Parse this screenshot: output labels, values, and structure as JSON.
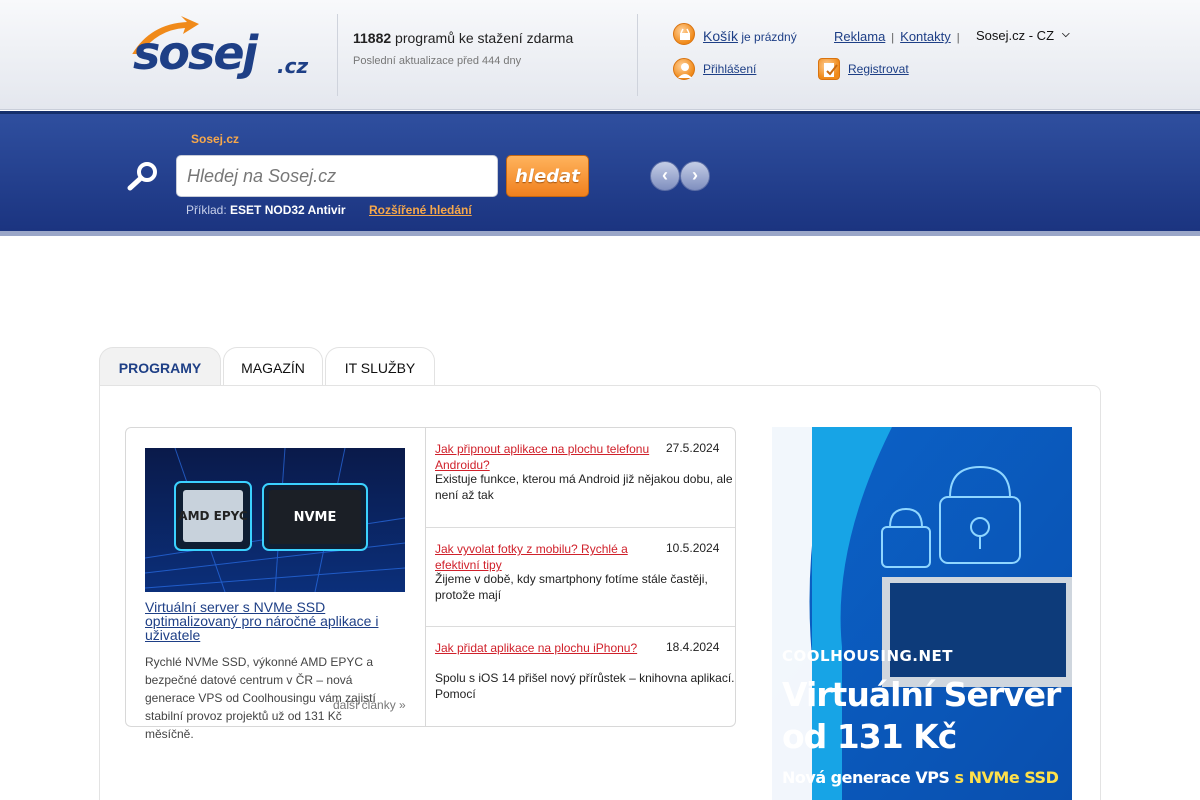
{
  "header": {
    "logo_text": "sosej",
    "logo_domain": ".cz",
    "program_count": "11882",
    "program_count_suffix": " programů ke stažení zdarma",
    "last_update": "Poslední aktualizace před 444 dny",
    "cart_link": "Košík",
    "cart_status": " je prázdný",
    "login_link": "Přihlášení",
    "register_link": "Registrovat",
    "top_links": [
      "Reklama",
      "Kontakty"
    ],
    "language_selected": "Sosej.cz - CZ"
  },
  "search": {
    "breadcrumb": "Sosej.cz",
    "placeholder": "Hledej na Sosej.cz",
    "button_label": "hledat",
    "example_label": "Příklad: ",
    "example_value": "ESET NOD32 Antivir",
    "advanced_link": "Rozšířené hledání"
  },
  "tabs": [
    {
      "label": "PROGRAMY",
      "active": true
    },
    {
      "label": "MAGAZÍN",
      "active": false
    },
    {
      "label": "IT SLUŽBY",
      "active": false
    }
  ],
  "feature": {
    "title": "Virtuální server s NVMe SSD optimalizovaný pro náročné aplikace i uživatele",
    "text": "Rychlé NVMe SSD, výkonné AMD EPYC a bezpečné datové centrum v ČR – nová generace VPS od Coolhousingu vám zajistí stabilní provoz projektů už od 131 Kč měsíčně.",
    "more_link": "další články »",
    "chip_left": "AMD EPYC",
    "chip_right": "NVME"
  },
  "news": [
    {
      "title": "Jak připnout aplikace na plochu telefonu Androidu?",
      "date": "27.5.2024",
      "text": "Existuje funkce, kterou má Android již nějakou dobu, ale není až tak"
    },
    {
      "title": "Jak vyvolat fotky z mobilu? Rychlé a efektivní tipy",
      "date": "10.5.2024",
      "text": "Žijeme v době, kdy smartphony fotíme stále častěji, protože mají"
    },
    {
      "title": "Jak přidat aplikace na plochu iPhonu?",
      "date": "18.4.2024",
      "text": "Spolu s iOS 14 přišel nový přírůstek – knihovna aplikací. Pomocí"
    }
  ],
  "ad": {
    "brand": "COOLHOUSING.NET",
    "title_line1": "Virtuální Server",
    "title_line2": "od 131 Kč",
    "sub_prefix": "Nová generace VPS ",
    "sub_highlight": "s NVMe SSD"
  },
  "colors": {
    "brand_blue": "#1e3f86",
    "accent_orange": "#f08a1a",
    "link_red": "#d0212b",
    "searchbar_blue": "#2a4795"
  }
}
